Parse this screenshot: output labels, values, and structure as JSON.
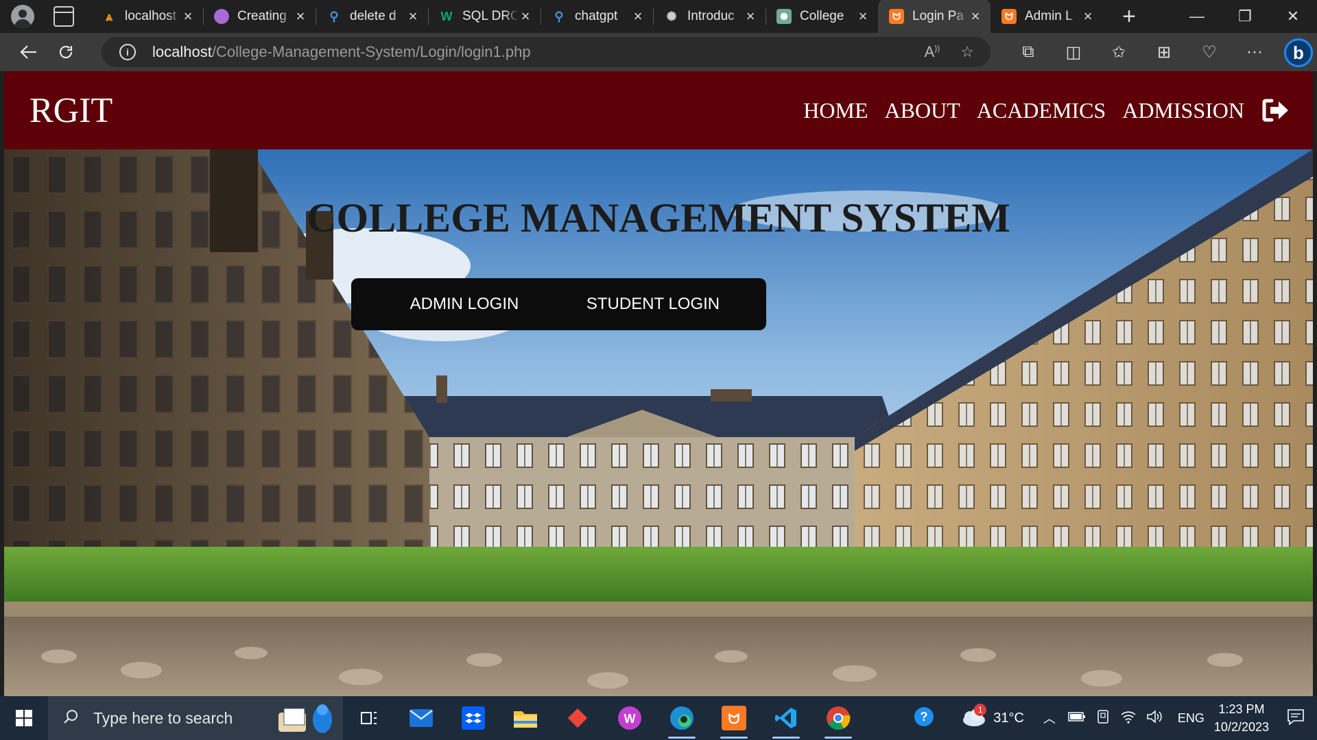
{
  "browser": {
    "tabs": [
      {
        "title": "localhost",
        "icon": "xampp-stack-icon",
        "color": "#f39c12"
      },
      {
        "title": "Creating",
        "icon": "avatar-icon",
        "color": "#a86ad8"
      },
      {
        "title": "delete d",
        "icon": "search-icon",
        "color": "#3b82f6"
      },
      {
        "title": "SQL DRO",
        "icon": "w3schools-icon",
        "color": "#04aa6d"
      },
      {
        "title": "chatgpt",
        "icon": "search-icon",
        "color": "#3b82f6"
      },
      {
        "title": "Introduc",
        "icon": "openai-icon",
        "color": "#cfcfcf"
      },
      {
        "title": "College",
        "icon": "chatgpt-icon",
        "color": "#74aa9c"
      },
      {
        "title": "Login Pa",
        "icon": "xampp-icon",
        "color": "#fb7a24"
      },
      {
        "title": "Admin L",
        "icon": "xampp-icon",
        "color": "#fb7a24"
      }
    ],
    "url_host": "localhost",
    "url_path": "/College-Management-System/Login/login1.php"
  },
  "site": {
    "brand": "RGIT",
    "nav": [
      "HOME",
      "ABOUT",
      "ACADEMICS",
      "ADMISSION"
    ],
    "title": "COLLEGE MANAGEMENT SYSTEM",
    "admin_login": "ADMIN LOGIN",
    "student_login": "STUDENT LOGIN",
    "header_color": "#5d0008"
  },
  "taskbar": {
    "search_placeholder": "Type here to search",
    "weather_temp": "31°C",
    "weather_badge": "1",
    "language": "ENG",
    "time": "1:23 PM",
    "date": "10/2/2023"
  }
}
